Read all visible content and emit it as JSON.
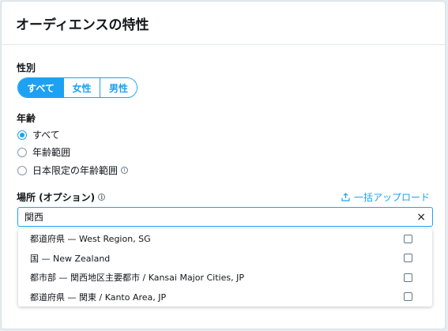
{
  "header": {
    "title": "オーディエンスの特性"
  },
  "gender": {
    "label": "性別",
    "options": [
      {
        "label": "すべて",
        "active": true
      },
      {
        "label": "女性",
        "active": false
      },
      {
        "label": "男性",
        "active": false
      }
    ]
  },
  "age": {
    "label": "年齢",
    "options": [
      {
        "label": "すべて",
        "checked": true
      },
      {
        "label": "年齢範囲",
        "checked": false
      },
      {
        "label": "日本限定の年齢範囲",
        "checked": false,
        "info": true
      }
    ]
  },
  "location": {
    "label": "場所 (オプション)",
    "upload_label": "一括アップロード",
    "search_value": "関西",
    "results": [
      {
        "label": "都道府県 — West Region, SG",
        "checked": false
      },
      {
        "label": "国 — New Zealand",
        "checked": false
      },
      {
        "label": "都市部 — 関西地区主要都市 / Kansai Major Cities, JP",
        "checked": false
      },
      {
        "label": "都道府県 — 関東 / Kanto Area, JP",
        "checked": false
      }
    ]
  },
  "colors": {
    "accent": "#1da1f2",
    "text": "#14171a",
    "muted": "#657786"
  }
}
